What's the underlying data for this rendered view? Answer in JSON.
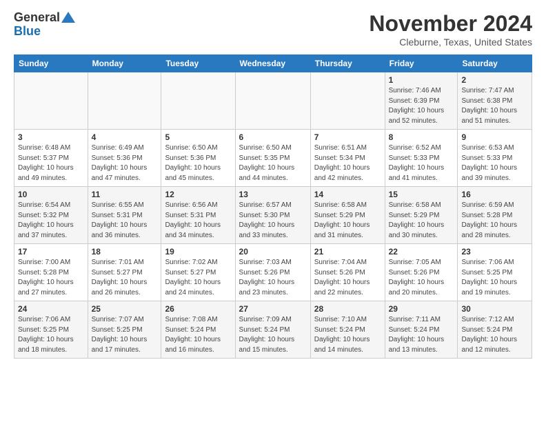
{
  "logo": {
    "general": "General",
    "blue": "Blue"
  },
  "header": {
    "month": "November 2024",
    "location": "Cleburne, Texas, United States"
  },
  "days_of_week": [
    "Sunday",
    "Monday",
    "Tuesday",
    "Wednesday",
    "Thursday",
    "Friday",
    "Saturday"
  ],
  "weeks": [
    [
      {
        "day": "",
        "info": ""
      },
      {
        "day": "",
        "info": ""
      },
      {
        "day": "",
        "info": ""
      },
      {
        "day": "",
        "info": ""
      },
      {
        "day": "",
        "info": ""
      },
      {
        "day": "1",
        "info": "Sunrise: 7:46 AM\nSunset: 6:39 PM\nDaylight: 10 hours and 52 minutes."
      },
      {
        "day": "2",
        "info": "Sunrise: 7:47 AM\nSunset: 6:38 PM\nDaylight: 10 hours and 51 minutes."
      }
    ],
    [
      {
        "day": "3",
        "info": "Sunrise: 6:48 AM\nSunset: 5:37 PM\nDaylight: 10 hours and 49 minutes."
      },
      {
        "day": "4",
        "info": "Sunrise: 6:49 AM\nSunset: 5:36 PM\nDaylight: 10 hours and 47 minutes."
      },
      {
        "day": "5",
        "info": "Sunrise: 6:50 AM\nSunset: 5:36 PM\nDaylight: 10 hours and 45 minutes."
      },
      {
        "day": "6",
        "info": "Sunrise: 6:50 AM\nSunset: 5:35 PM\nDaylight: 10 hours and 44 minutes."
      },
      {
        "day": "7",
        "info": "Sunrise: 6:51 AM\nSunset: 5:34 PM\nDaylight: 10 hours and 42 minutes."
      },
      {
        "day": "8",
        "info": "Sunrise: 6:52 AM\nSunset: 5:33 PM\nDaylight: 10 hours and 41 minutes."
      },
      {
        "day": "9",
        "info": "Sunrise: 6:53 AM\nSunset: 5:33 PM\nDaylight: 10 hours and 39 minutes."
      }
    ],
    [
      {
        "day": "10",
        "info": "Sunrise: 6:54 AM\nSunset: 5:32 PM\nDaylight: 10 hours and 37 minutes."
      },
      {
        "day": "11",
        "info": "Sunrise: 6:55 AM\nSunset: 5:31 PM\nDaylight: 10 hours and 36 minutes."
      },
      {
        "day": "12",
        "info": "Sunrise: 6:56 AM\nSunset: 5:31 PM\nDaylight: 10 hours and 34 minutes."
      },
      {
        "day": "13",
        "info": "Sunrise: 6:57 AM\nSunset: 5:30 PM\nDaylight: 10 hours and 33 minutes."
      },
      {
        "day": "14",
        "info": "Sunrise: 6:58 AM\nSunset: 5:29 PM\nDaylight: 10 hours and 31 minutes."
      },
      {
        "day": "15",
        "info": "Sunrise: 6:58 AM\nSunset: 5:29 PM\nDaylight: 10 hours and 30 minutes."
      },
      {
        "day": "16",
        "info": "Sunrise: 6:59 AM\nSunset: 5:28 PM\nDaylight: 10 hours and 28 minutes."
      }
    ],
    [
      {
        "day": "17",
        "info": "Sunrise: 7:00 AM\nSunset: 5:28 PM\nDaylight: 10 hours and 27 minutes."
      },
      {
        "day": "18",
        "info": "Sunrise: 7:01 AM\nSunset: 5:27 PM\nDaylight: 10 hours and 26 minutes."
      },
      {
        "day": "19",
        "info": "Sunrise: 7:02 AM\nSunset: 5:27 PM\nDaylight: 10 hours and 24 minutes."
      },
      {
        "day": "20",
        "info": "Sunrise: 7:03 AM\nSunset: 5:26 PM\nDaylight: 10 hours and 23 minutes."
      },
      {
        "day": "21",
        "info": "Sunrise: 7:04 AM\nSunset: 5:26 PM\nDaylight: 10 hours and 22 minutes."
      },
      {
        "day": "22",
        "info": "Sunrise: 7:05 AM\nSunset: 5:26 PM\nDaylight: 10 hours and 20 minutes."
      },
      {
        "day": "23",
        "info": "Sunrise: 7:06 AM\nSunset: 5:25 PM\nDaylight: 10 hours and 19 minutes."
      }
    ],
    [
      {
        "day": "24",
        "info": "Sunrise: 7:06 AM\nSunset: 5:25 PM\nDaylight: 10 hours and 18 minutes."
      },
      {
        "day": "25",
        "info": "Sunrise: 7:07 AM\nSunset: 5:25 PM\nDaylight: 10 hours and 17 minutes."
      },
      {
        "day": "26",
        "info": "Sunrise: 7:08 AM\nSunset: 5:24 PM\nDaylight: 10 hours and 16 minutes."
      },
      {
        "day": "27",
        "info": "Sunrise: 7:09 AM\nSunset: 5:24 PM\nDaylight: 10 hours and 15 minutes."
      },
      {
        "day": "28",
        "info": "Sunrise: 7:10 AM\nSunset: 5:24 PM\nDaylight: 10 hours and 14 minutes."
      },
      {
        "day": "29",
        "info": "Sunrise: 7:11 AM\nSunset: 5:24 PM\nDaylight: 10 hours and 13 minutes."
      },
      {
        "day": "30",
        "info": "Sunrise: 7:12 AM\nSunset: 5:24 PM\nDaylight: 10 hours and 12 minutes."
      }
    ]
  ]
}
